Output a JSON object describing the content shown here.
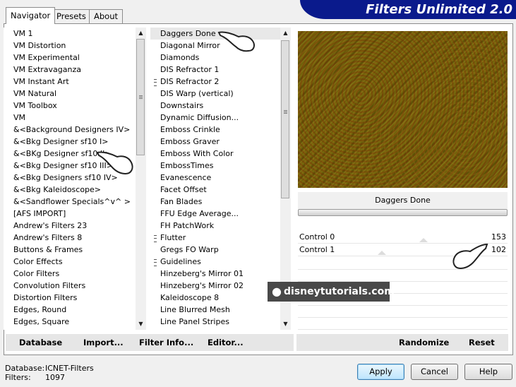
{
  "window": {
    "title": "Filters Unlimited 2.0"
  },
  "tabs": [
    {
      "label": "Navigator"
    },
    {
      "label": "Presets"
    },
    {
      "label": "About"
    }
  ],
  "categories": [
    "VM 1",
    "VM Distortion",
    "VM Experimental",
    "VM Extravaganza",
    "VM Instant Art",
    "VM Natural",
    "VM Toolbox",
    "VM",
    "&<Background Designers IV>",
    "&<Bkg Designer sf10 I>",
    "&<BKg Designer sf10 II>",
    "&<Bkg Designer sf10 III>",
    "&<Bkg Designers sf10 IV>",
    "&<Bkg Kaleidoscope>",
    "&<Sandflower Specials^v^ >",
    "[AFS IMPORT]",
    "Andrew's Filters 23",
    "Andrew's Filters 8",
    "Buttons & Frames",
    "Color Effects",
    "Color Filters",
    "Convolution Filters",
    "Distortion Filters",
    "Edges, Round",
    "Edges, Square"
  ],
  "filters": [
    {
      "label": "Daggers Done",
      "grouped": false
    },
    {
      "label": "Diagonal Mirror",
      "grouped": false
    },
    {
      "label": "Diamonds",
      "grouped": false
    },
    {
      "label": "DIS Refractor 1",
      "grouped": false
    },
    {
      "label": "DIS Refractor 2",
      "grouped": true
    },
    {
      "label": "DIS Warp (vertical)",
      "grouped": false
    },
    {
      "label": "Downstairs",
      "grouped": false
    },
    {
      "label": "Dynamic Diffusion...",
      "grouped": false
    },
    {
      "label": "Emboss Crinkle",
      "grouped": false
    },
    {
      "label": "Emboss Graver",
      "grouped": false
    },
    {
      "label": "Emboss With Color",
      "grouped": false
    },
    {
      "label": "EmbossTimes",
      "grouped": false
    },
    {
      "label": "Evanescence",
      "grouped": false
    },
    {
      "label": "Facet Offset",
      "grouped": false
    },
    {
      "label": "Fan Blades",
      "grouped": false
    },
    {
      "label": "FFU Edge Average...",
      "grouped": false
    },
    {
      "label": "FH PatchWork",
      "grouped": false
    },
    {
      "label": "Flutter",
      "grouped": true
    },
    {
      "label": "Gregs FO Warp",
      "grouped": false
    },
    {
      "label": "Guidelines",
      "grouped": true
    },
    {
      "label": "Hinzeberg's Mirror 01",
      "grouped": false
    },
    {
      "label": "Hinzeberg's Mirror 02",
      "grouped": false
    },
    {
      "label": "Kaleidoscope 8",
      "grouped": false
    },
    {
      "label": "Line Blurred Mesh",
      "grouped": false
    },
    {
      "label": "Line Panel Stripes",
      "grouped": false
    }
  ],
  "selected_category_index": 10,
  "selected_filter_index": 0,
  "preview": {
    "filter_name": "Daggers Done"
  },
  "controls": [
    {
      "label": "Control 0",
      "value": "153",
      "fraction": 0.6
    },
    {
      "label": "Control  1",
      "value": "102",
      "fraction": 0.4
    }
  ],
  "toolbar": {
    "database": "Database",
    "import": "Import...",
    "filter_info": "Filter Info...",
    "editor": "Editor...",
    "randomize": "Randomize",
    "reset": "Reset"
  },
  "status": {
    "database_label": "Database:",
    "database_value": "ICNET-Filters",
    "filters_label": "Filters:",
    "filters_value": "1097"
  },
  "buttons": {
    "apply": "Apply",
    "cancel": "Cancel",
    "help": "Help"
  },
  "watermark": "disneytutorials.com",
  "colors": {
    "banner": "#0a1a8c",
    "preview_tint": "#6a5608"
  }
}
